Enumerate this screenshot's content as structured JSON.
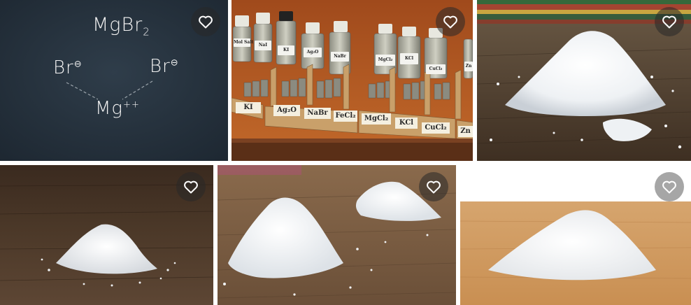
{
  "gallery": {
    "favorite_icon": "heart-outline-icon",
    "tiles": [
      {
        "name": "mgbr2-chalkboard-diagram",
        "chalk": {
          "formula_main": "MgBr",
          "formula_sub": "2",
          "ion_left": "Br",
          "ion_right": "Br",
          "ion_charge": "⊖",
          "cation": "Mg",
          "cation_charge": "++"
        }
      },
      {
        "name": "chemical-bottles-shelf",
        "bottle_labels": [
          "Mol Salt",
          "NaI",
          "KI",
          "Ag₂O",
          "NaBr",
          "MgCl₂",
          "KCl",
          "CuCl₂",
          "Zn"
        ],
        "shelf_labels": [
          "KI",
          "Ag₂O",
          "NaBr",
          "FeCl₂",
          "MgCl₂",
          "KCl",
          "CuCl₂",
          "Zn"
        ]
      },
      {
        "name": "white-crystals-on-wood-striped-background"
      },
      {
        "name": "white-salt-pile-dark-wood"
      },
      {
        "name": "salt-piles-on-wood"
      },
      {
        "name": "white-powder-pile-light-wood"
      }
    ]
  }
}
